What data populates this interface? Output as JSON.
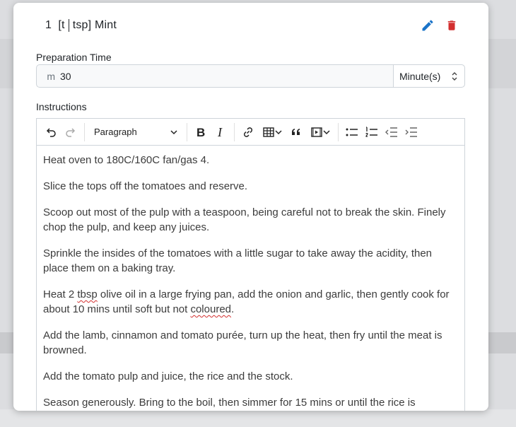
{
  "ingredient": {
    "quantity": "1",
    "unit_a": "[t",
    "unit_b": "tsp]",
    "name": "Mint"
  },
  "preparation": {
    "label": "Preparation Time",
    "prefix": "m",
    "value": "30",
    "unit_selected": "Minute(s)"
  },
  "instructions": {
    "label": "Instructions",
    "block_format": "Paragraph",
    "paragraphs": [
      "Heat oven to 180C/160C fan/gas 4.",
      "Slice the tops off the tomatoes and reserve.",
      "Scoop out most of the pulp with a teaspoon, being careful not to break the skin. Finely chop the pulp, and keep any juices.",
      "Sprinkle the insides of the tomatoes with a little sugar to take away the acidity, then place them on a baking tray.",
      {
        "before": "Heat 2 ",
        "spell1": "tbsp",
        "middle": " olive oil in a large frying pan, add the onion and garlic, then gently cook for about 10 mins until soft but not ",
        "spell2": "coloured",
        "after": "."
      },
      "Add the lamb, cinnamon and tomato purée, turn up the heat, then fry until the meat is browned.",
      "Add the tomato pulp and juice, the rice and the stock.",
      "Season generously. Bring to the boil, then simmer for 15 mins or until the rice is"
    ]
  },
  "colors": {
    "edit": "#1a73c8",
    "delete": "#d32f2f"
  }
}
